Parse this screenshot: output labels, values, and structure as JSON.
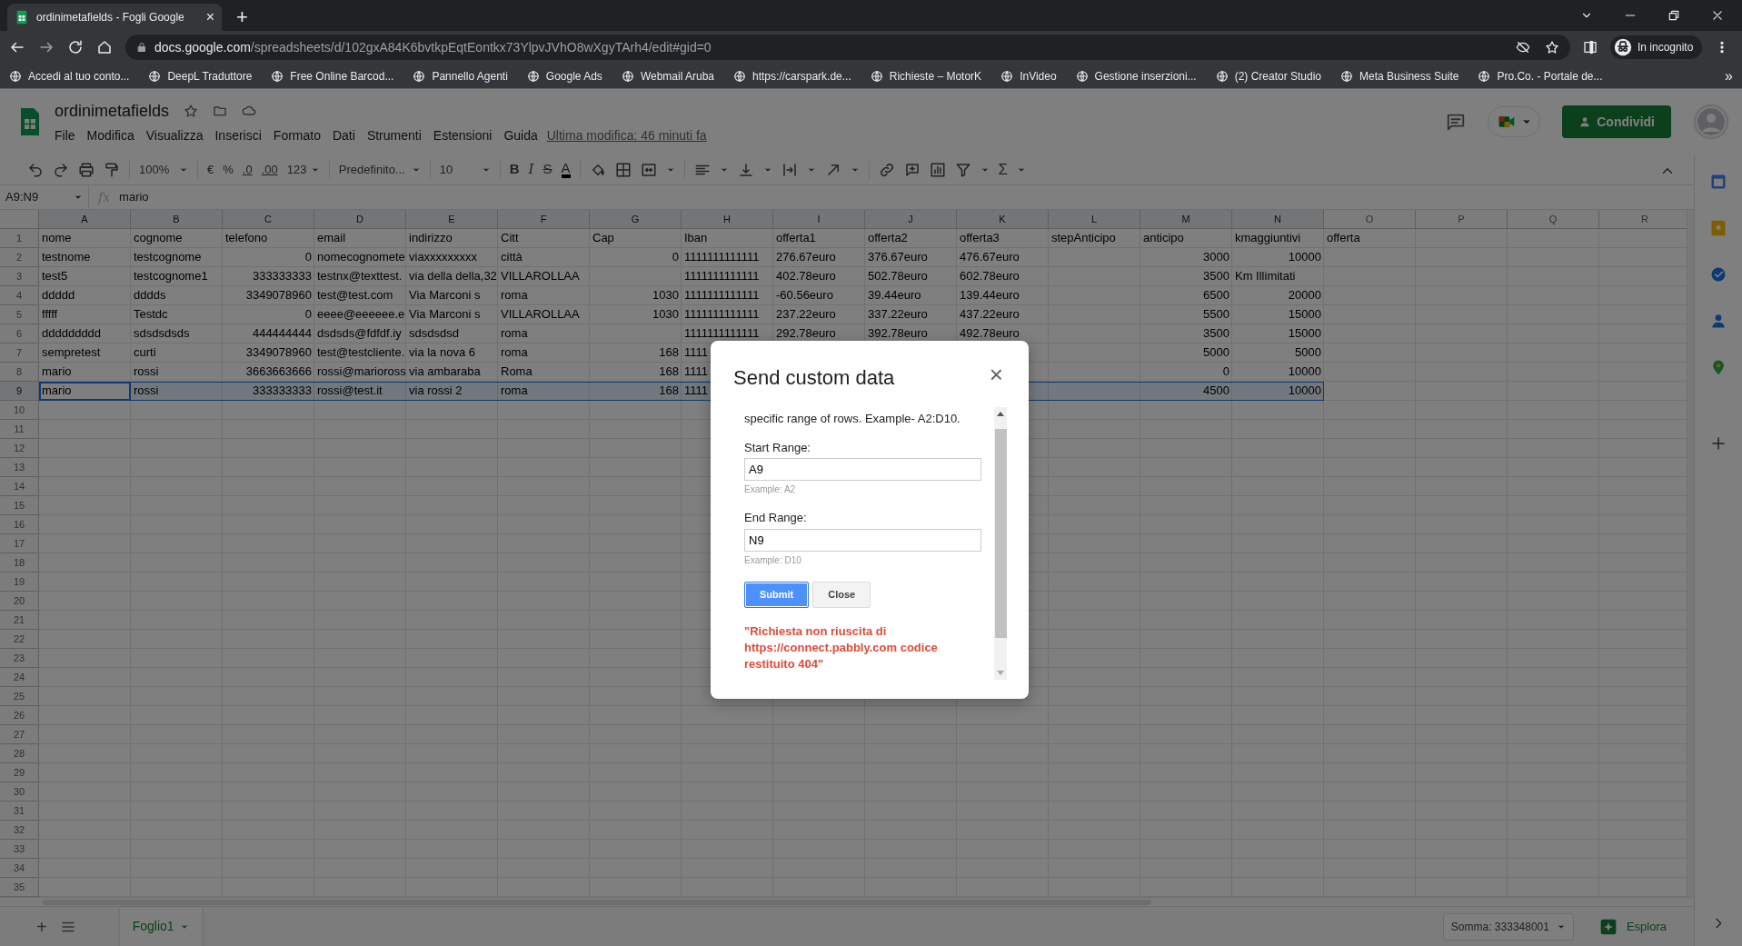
{
  "browser": {
    "tab_title": "ordinimetafields - Fogli Google",
    "tab_close": "×",
    "new_tab": "+",
    "url_host": "docs.google.com",
    "url_path": "/spreadsheets/d/102gxA84K6bvtkpEqtEontkx73YlpvJVhO8wXgyTArh4/edit#gid=0",
    "profile": "In incognito",
    "more_bookmarks": "»",
    "bookmarks": [
      "Accedi al tuo conto...",
      "DeepL Traduttore",
      "Free Online Barcod...",
      "Pannello Agenti",
      "Google Ads",
      "Webmail Aruba",
      "https://carspark.de...",
      "Richieste – MotorK",
      "InVideo",
      "Gestione inserzioni...",
      "(2) Creator Studio",
      "Meta Business Suite",
      "Pro.Co. - Portale de..."
    ]
  },
  "sheet": {
    "title": "ordinimetafields",
    "menus": [
      "File",
      "Modifica",
      "Visualizza",
      "Inserisci",
      "Formato",
      "Dati",
      "Strumenti",
      "Estensioni",
      "Guida"
    ],
    "last_edit": "Ultima modifica: 46 minuti fa",
    "share_button": "Condividi"
  },
  "toolbar": {
    "zoom": "100%",
    "currency": "€",
    "percent": "%",
    "decrease_decimals": ".0",
    "increase_decimals": ".00",
    "number_format": "123",
    "font": "Predefinito...",
    "font_size": "10",
    "bold": "B",
    "italic": "I",
    "strikethrough": "S",
    "text_color": "A",
    "functions": "Σ"
  },
  "formula_bar": {
    "name_box": "A9:N9",
    "fx": "fx",
    "formula": "mario"
  },
  "columns": [
    "A",
    "B",
    "C",
    "D",
    "E",
    "F",
    "G",
    "H",
    "I",
    "J",
    "K",
    "L",
    "M",
    "N",
    "O",
    "P",
    "Q",
    "R"
  ],
  "rows": [
    {
      "number": "1",
      "selected": false,
      "cells": [
        "nome",
        "cognome",
        "telefono",
        "email",
        "indirizzo",
        "Citt",
        "Cap",
        "Iban",
        "offerta1",
        "offerta2",
        "offerta3",
        "stepAnticipo",
        "anticipo",
        "kmaggiuntivi",
        "offerta"
      ]
    },
    {
      "number": "2",
      "selected": false,
      "cells": [
        "testnome",
        "testcognome",
        {
          "kind": "number",
          "text": "0"
        },
        "nomecognomete",
        "viaxxxxxxxxx",
        "città",
        {
          "kind": "number",
          "text": "0"
        },
        "1111111111111",
        "276.67euro",
        "376.67euro",
        "476.67euro",
        null,
        {
          "kind": "number",
          "text": "3000"
        },
        {
          "kind": "number",
          "text": "10000"
        }
      ]
    },
    {
      "number": "3",
      "selected": false,
      "cells": [
        "test5",
        "testcognome1",
        {
          "kind": "number",
          "text": "333333333"
        },
        "testnx@texttest.",
        "via della della,32",
        "VILLAROLLAA",
        null,
        "1111111111111",
        "402.78euro",
        "502.78euro",
        "602.78euro",
        null,
        {
          "kind": "number",
          "text": "3500"
        },
        "Km Illimitati"
      ]
    },
    {
      "number": "4",
      "selected": false,
      "cells": [
        "ddddd",
        "dddds",
        {
          "kind": "number",
          "text": "3349078960"
        },
        "test@test.com",
        "Via Marconi s",
        "roma",
        {
          "kind": "number",
          "text": "1030"
        },
        "1111111111111",
        "-60.56euro",
        "39.44euro",
        "139.44euro",
        null,
        {
          "kind": "number",
          "text": "6500"
        },
        {
          "kind": "number",
          "text": "20000"
        }
      ]
    },
    {
      "number": "5",
      "selected": false,
      "cells": [
        "fffff",
        "Testdc",
        {
          "kind": "number",
          "text": "0"
        },
        "eeee@eeeeee.e",
        "Via Marconi s",
        "VILLAROLLAA",
        {
          "kind": "number",
          "text": "1030"
        },
        "1111111111111",
        "237.22euro",
        "337.22euro",
        "437.22euro",
        null,
        {
          "kind": "number",
          "text": "5500"
        },
        {
          "kind": "number",
          "text": "15000"
        }
      ]
    },
    {
      "number": "6",
      "selected": false,
      "cells": [
        "ddddddddd",
        "sdsdsdsds",
        {
          "kind": "number",
          "text": "444444444"
        },
        "dsdsds@fdfdf.iy",
        "sdsdsdsd",
        "roma",
        null,
        "1111111111111",
        "292.78euro",
        "392.78euro",
        "492.78euro",
        null,
        {
          "kind": "number",
          "text": "3500"
        },
        {
          "kind": "number",
          "text": "15000"
        }
      ]
    },
    {
      "number": "7",
      "selected": false,
      "cells": [
        "sempretest",
        "curti",
        {
          "kind": "number",
          "text": "3349078960"
        },
        "test@testcliente.",
        "via la nova 6",
        "roma",
        {
          "kind": "number",
          "text": "168"
        },
        "1111",
        null,
        null,
        null,
        null,
        {
          "kind": "number",
          "text": "5000"
        },
        {
          "kind": "number",
          "text": "5000"
        }
      ]
    },
    {
      "number": "8",
      "selected": false,
      "cells": [
        "mario",
        "rossi",
        {
          "kind": "number",
          "text": "3663663666"
        },
        "rossi@marioross",
        "via ambaraba",
        "Roma",
        {
          "kind": "number",
          "text": "168"
        },
        "1111",
        null,
        null,
        null,
        null,
        {
          "kind": "number",
          "text": "0"
        },
        {
          "kind": "number",
          "text": "10000"
        }
      ]
    },
    {
      "number": "9",
      "selected": true,
      "cells": [
        "mario",
        "rossi",
        {
          "kind": "number",
          "text": "333333333"
        },
        "rossi@test.it",
        "via rossi 2",
        "roma",
        {
          "kind": "number",
          "text": "168"
        },
        "1111",
        null,
        null,
        null,
        null,
        {
          "kind": "number",
          "text": "4500"
        },
        {
          "kind": "number",
          "text": "10000"
        }
      ]
    },
    {
      "number": "10",
      "selected": false,
      "cells": []
    },
    {
      "number": "11",
      "selected": false,
      "cells": []
    },
    {
      "number": "12",
      "selected": false,
      "cells": []
    },
    {
      "number": "13",
      "selected": false,
      "cells": []
    },
    {
      "number": "14",
      "selected": false,
      "cells": []
    },
    {
      "number": "15",
      "selected": false,
      "cells": []
    },
    {
      "number": "16",
      "selected": false,
      "cells": []
    },
    {
      "number": "17",
      "selected": false,
      "cells": []
    },
    {
      "number": "18",
      "selected": false,
      "cells": []
    },
    {
      "number": "19",
      "selected": false,
      "cells": []
    },
    {
      "number": "20",
      "selected": false,
      "cells": []
    },
    {
      "number": "21",
      "selected": false,
      "cells": []
    },
    {
      "number": "22",
      "selected": false,
      "cells": []
    },
    {
      "number": "23",
      "selected": false,
      "cells": []
    },
    {
      "number": "24",
      "selected": false,
      "cells": []
    },
    {
      "number": "25",
      "selected": false,
      "cells": []
    },
    {
      "number": "26",
      "selected": false,
      "cells": []
    },
    {
      "number": "27",
      "selected": false,
      "cells": []
    },
    {
      "number": "28",
      "selected": false,
      "cells": []
    },
    {
      "number": "29",
      "selected": false,
      "cells": []
    },
    {
      "number": "30",
      "selected": false,
      "cells": []
    },
    {
      "number": "31",
      "selected": false,
      "cells": []
    },
    {
      "number": "32",
      "selected": false,
      "cells": []
    },
    {
      "number": "33",
      "selected": false,
      "cells": []
    },
    {
      "number": "34",
      "selected": false,
      "cells": []
    },
    {
      "number": "35",
      "selected": false,
      "cells": []
    }
  ],
  "bottom_bar": {
    "add_sheet": "+",
    "sheets": [
      {
        "label": "Foglio1",
        "selected": true
      }
    ],
    "sum": "Somma: 333348001",
    "explore": "Esplora"
  },
  "dialog": {
    "title": "Send custom data",
    "close": "×",
    "intro": "specific range of rows. Example- A2:D10.",
    "fields": [
      {
        "label": "Start Range:",
        "value": "A9",
        "hint": "Example: A2"
      },
      {
        "label": "End Range:",
        "value": "N9",
        "hint": "Example: D10"
      }
    ],
    "buttons": [
      {
        "label": "Submit",
        "kind": "primary"
      },
      {
        "label": "Close",
        "kind": "secondary"
      }
    ],
    "error": "\"Richiesta non riuscita di https://connect.pabbly.com codice restituito 404\""
  }
}
